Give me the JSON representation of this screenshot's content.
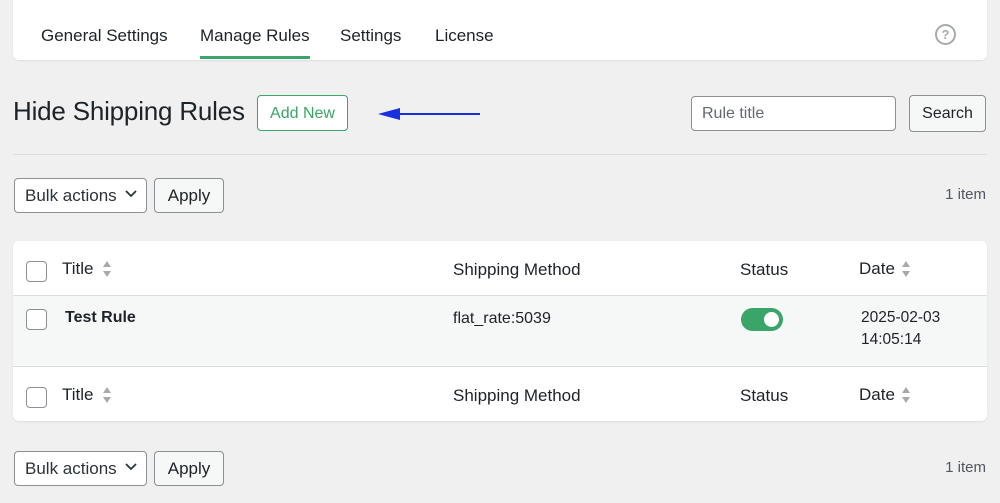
{
  "tabs": [
    {
      "label": "General Settings",
      "active": false
    },
    {
      "label": "Manage Rules",
      "active": true
    },
    {
      "label": "Settings",
      "active": false
    },
    {
      "label": "License",
      "active": false
    }
  ],
  "help_icon": "question-circle-icon",
  "page": {
    "title": "Hide Shipping Rules",
    "add_new_label": "Add New"
  },
  "search": {
    "placeholder": "Rule title",
    "value": "",
    "button_label": "Search"
  },
  "bulk": {
    "selected": "Bulk actions",
    "apply_label": "Apply",
    "count": "1 item"
  },
  "table": {
    "columns": [
      "Title",
      "Shipping Method",
      "Status",
      "Date"
    ],
    "rows": [
      {
        "title": "Test Rule",
        "shipping_method": "flat_rate:5039",
        "status_on": true,
        "date": "2025-02-03",
        "time": "14:05:14"
      }
    ]
  },
  "colors": {
    "accent": "#3aa568",
    "arrow": "#1a2fe0",
    "background": "#f0f0f1"
  }
}
